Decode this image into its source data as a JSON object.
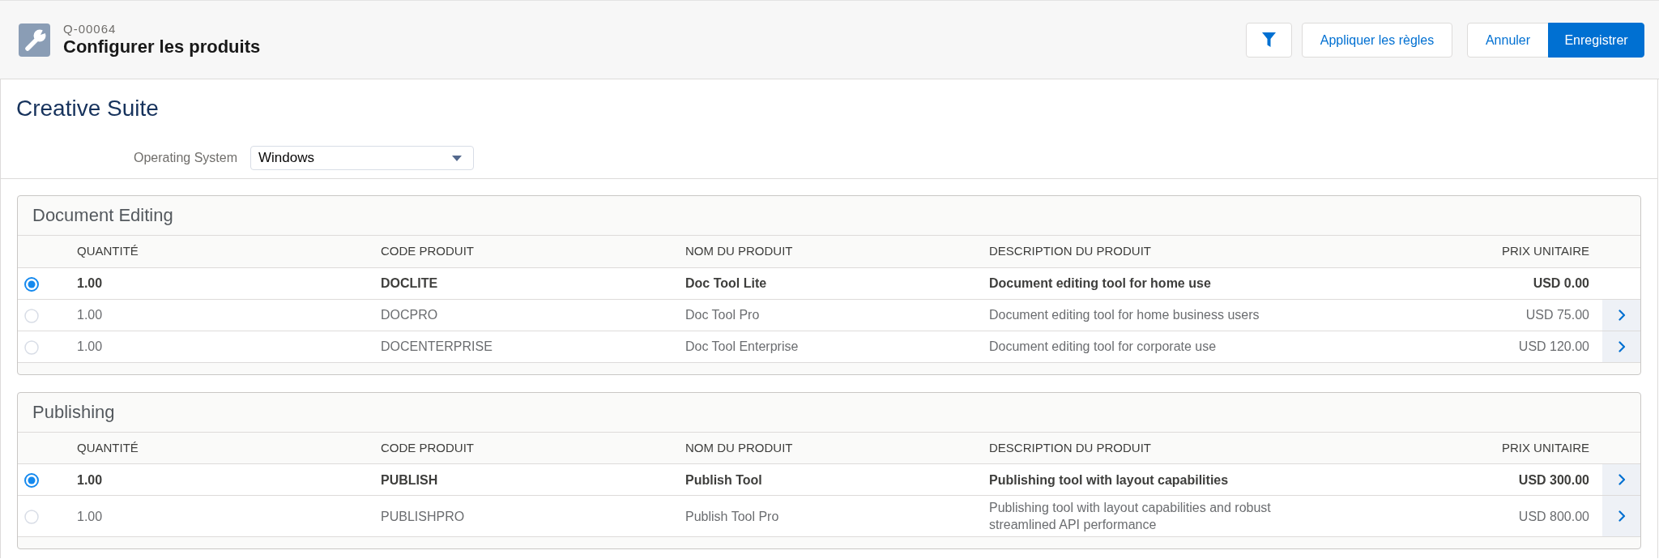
{
  "header": {
    "record_number": "Q-00064",
    "title": "Configurer les produits",
    "toolbar": [
      {
        "kind": "filter"
      },
      {
        "kind": "text",
        "label": "Appliquer les règles"
      }
    ],
    "actions": [
      {
        "label": "Annuler",
        "primary": false
      },
      {
        "label": "Enregistrer",
        "primary": true
      }
    ]
  },
  "bundle": {
    "title": "Creative Suite",
    "fields": [
      {
        "label": "Operating System",
        "value": "Windows"
      }
    ]
  },
  "groups": [
    {
      "title": "Document Editing",
      "columns": [
        "QUANTITÉ",
        "CODE PRODUIT",
        "NOM DU PRODUIT",
        "DESCRIPTION DU PRODUIT",
        "PRIX UNITAIRE"
      ],
      "rows": [
        {
          "selected": true,
          "quantity": "1.00",
          "code": "DOCLITE",
          "name": "Doc Tool Lite",
          "description": "Document editing tool for home use",
          "price": "USD 0.00",
          "config_button": false
        },
        {
          "selected": false,
          "quantity": "1.00",
          "code": "DOCPRO",
          "name": "Doc Tool Pro",
          "description": "Document editing tool for home business users",
          "price": "USD 75.00",
          "config_button": true
        },
        {
          "selected": false,
          "quantity": "1.00",
          "code": "DOCENTERPRISE",
          "name": "Doc Tool Enterprise",
          "description": "Document editing tool for corporate use",
          "price": "USD 120.00",
          "config_button": true
        }
      ]
    },
    {
      "title": "Publishing",
      "columns": [
        "QUANTITÉ",
        "CODE PRODUIT",
        "NOM DU PRODUIT",
        "DESCRIPTION DU PRODUIT",
        "PRIX UNITAIRE"
      ],
      "rows": [
        {
          "selected": true,
          "quantity": "1.00",
          "code": "PUBLISH",
          "name": "Publish Tool",
          "description": "Publishing tool with layout capabilities",
          "price": "USD 300.00",
          "config_button": true
        },
        {
          "selected": false,
          "quantity": "1.00",
          "code": "PUBLISHPRO",
          "name": "Publish Tool Pro",
          "description": "Publishing tool with layout capabilities and robust streamlined API performance",
          "price": "USD 800.00",
          "config_button": true
        }
      ]
    }
  ]
}
